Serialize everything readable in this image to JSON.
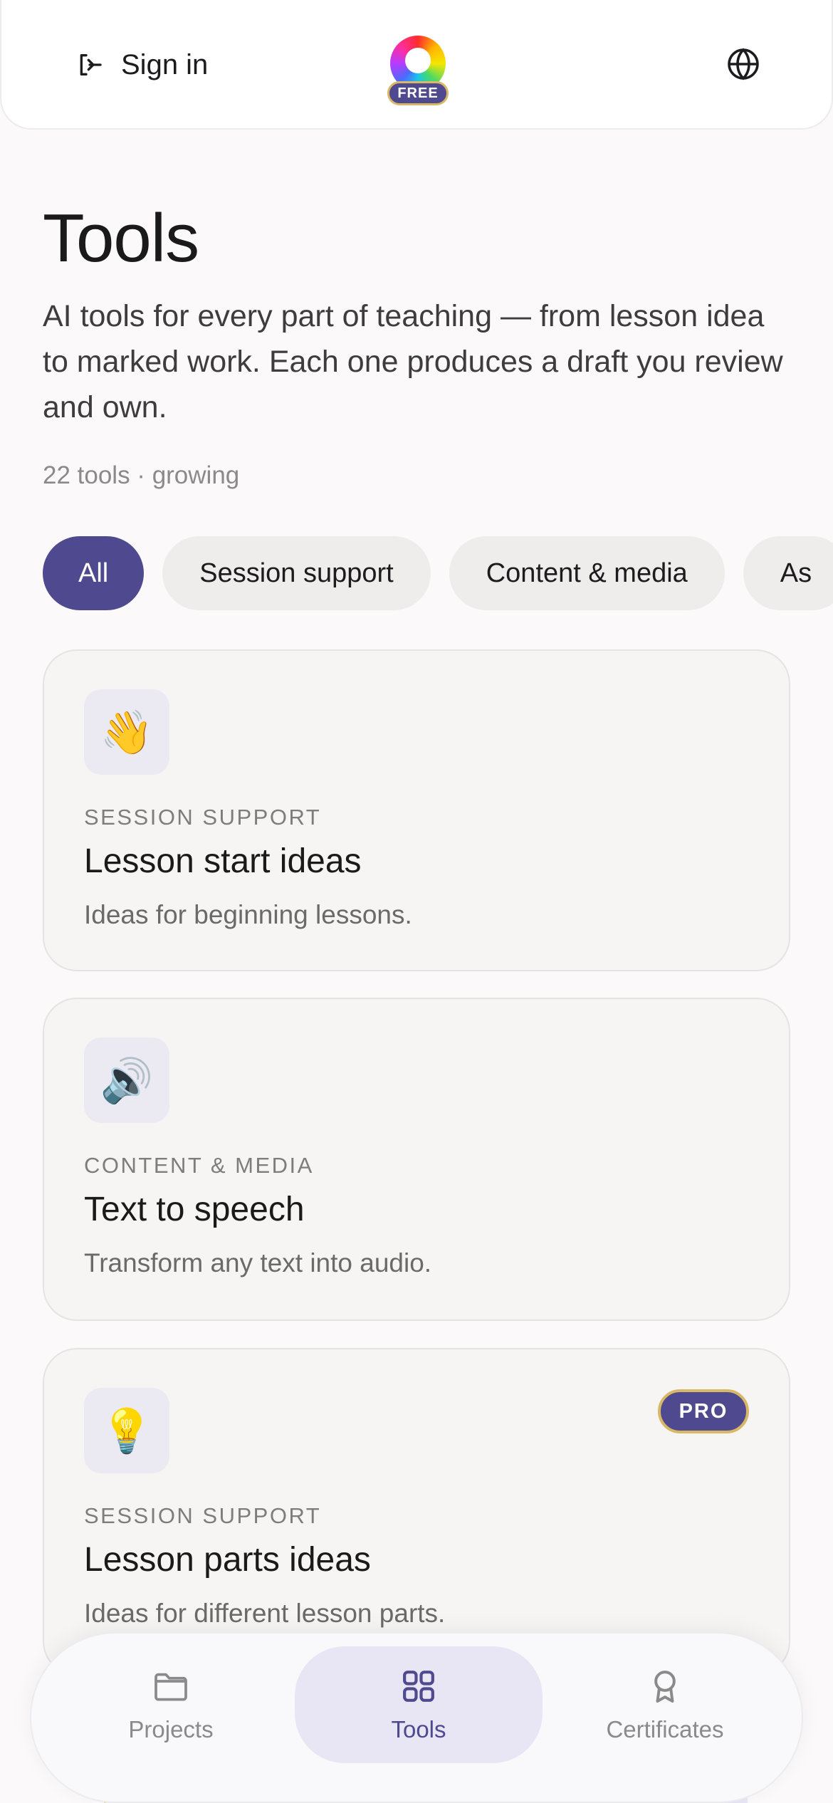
{
  "header": {
    "signin_label": "Sign in",
    "logo_badge": "FREE"
  },
  "page": {
    "title": "Tools",
    "subtitle": "AI tools for every part of teaching — from lesson idea to marked work. Each one produces a draft you review and own.",
    "count": "22 tools · growing"
  },
  "filters": [
    {
      "label": "All",
      "active": true
    },
    {
      "label": "Session support",
      "active": false
    },
    {
      "label": "Content & media",
      "active": false
    },
    {
      "label": "As",
      "active": false
    }
  ],
  "cards": [
    {
      "icon": "waving-hand-icon",
      "emoji": "👋",
      "category": "SESSION SUPPORT",
      "name": "Lesson start ideas",
      "description": "Ideas for beginning lessons.",
      "pro": false
    },
    {
      "icon": "speaker-icon",
      "emoji": "🔊",
      "category": "CONTENT & MEDIA",
      "name": "Text to speech",
      "description": "Transform any text into audio.",
      "pro": false
    },
    {
      "icon": "lightbulb-icon",
      "emoji": "💡",
      "category": "SESSION SUPPORT",
      "name": "Lesson parts ideas",
      "description": "Ideas for different lesson parts.",
      "pro": true,
      "pro_label": "PRO"
    }
  ],
  "nav": [
    {
      "label": "Projects",
      "icon": "folder-icon",
      "active": false
    },
    {
      "label": "Tools",
      "icon": "grid-icon",
      "active": true
    },
    {
      "label": "Certificates",
      "icon": "award-icon",
      "active": false
    }
  ],
  "colors": {
    "accent": "#4f4a8f",
    "gold": "#d8b866",
    "background": "#fbf9f9",
    "card": "#f6f5f3"
  }
}
